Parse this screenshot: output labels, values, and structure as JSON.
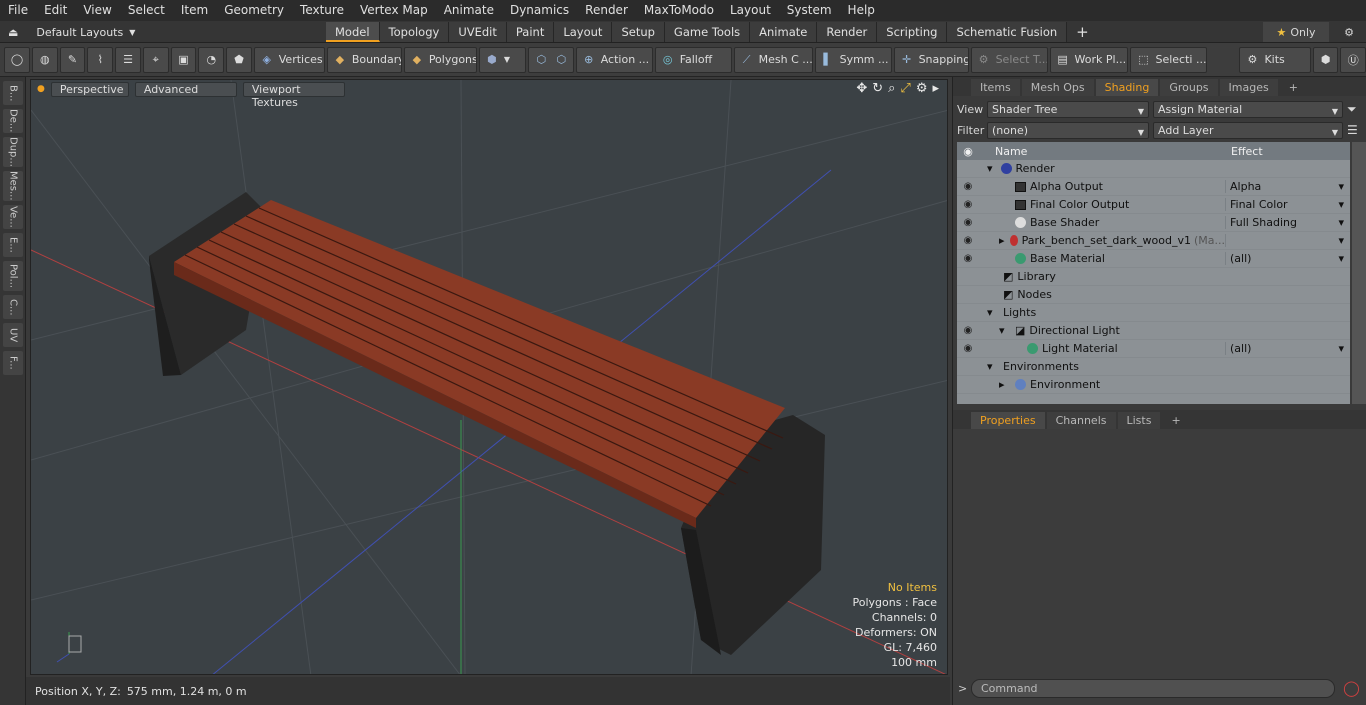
{
  "menu": [
    "File",
    "Edit",
    "View",
    "Select",
    "Item",
    "Geometry",
    "Texture",
    "Vertex Map",
    "Animate",
    "Dynamics",
    "Render",
    "MaxToModo",
    "Layout",
    "System",
    "Help"
  ],
  "layout_selector": "Default Layouts",
  "mode_tabs": [
    "Model",
    "Topology",
    "UVEdit",
    "Paint",
    "Layout",
    "Setup",
    "Game Tools",
    "Animate",
    "Render",
    "Scripting",
    "Schematic Fusion"
  ],
  "only_label": "Only",
  "toolbar": {
    "vertices": "Vertices",
    "boundary": "Boundary",
    "polygons": "Polygons",
    "action": "Action ...",
    "falloff": "Falloff",
    "mesh": "Mesh C ...",
    "symm": "Symm ...",
    "snapping": "Snapping",
    "select_t": "Select T...",
    "work_pl": "Work Pl...",
    "selecti": "Selecti ...",
    "kits": "Kits"
  },
  "left_tabs": [
    "B...",
    "De...",
    "Dup...",
    "Mes...",
    "Ve...",
    "E...",
    "Pol...",
    "C...",
    "UV",
    "F..."
  ],
  "viewport": {
    "perspective": "Perspective",
    "advanced": "Advanced",
    "viewport_textures": "Viewport Textures",
    "info": {
      "no_items": "No Items",
      "polygons": "Polygons : Face",
      "channels": "Channels: 0",
      "deformers": "Deformers: ON",
      "gl": "GL: 7,460",
      "unit": "100 mm"
    }
  },
  "status": {
    "label": "Position X, Y, Z:",
    "value": "575 mm, 1.24 m, 0 m"
  },
  "panel_tabs": [
    "Items",
    "Mesh Ops",
    "Shading",
    "Groups",
    "Images"
  ],
  "shading": {
    "view_label": "View",
    "view_value": "Shader Tree",
    "assign": "Assign Material",
    "filter_label": "Filter",
    "filter_value": "(none)",
    "add_layer": "Add Layer",
    "col_name": "Name",
    "col_effect": "Effect",
    "rows": [
      {
        "name": "Render",
        "effect": ""
      },
      {
        "name": "Alpha Output",
        "effect": "Alpha"
      },
      {
        "name": "Final Color Output",
        "effect": "Final Color"
      },
      {
        "name": "Base Shader",
        "effect": "Full Shading"
      },
      {
        "name": "Park_bench_set_dark_wood_v1",
        "suffix": "(Ma...",
        "effect": ""
      },
      {
        "name": "Base Material",
        "effect": "(all)"
      },
      {
        "name": "Library",
        "effect": ""
      },
      {
        "name": "Nodes",
        "effect": ""
      },
      {
        "name": "Lights",
        "effect": ""
      },
      {
        "name": "Directional Light",
        "effect": ""
      },
      {
        "name": "Light Material",
        "effect": "(all)"
      },
      {
        "name": "Environments",
        "effect": ""
      },
      {
        "name": "Environment",
        "effect": ""
      }
    ]
  },
  "lower_tabs": [
    "Properties",
    "Channels",
    "Lists"
  ],
  "command_placeholder": "Command",
  "colors": {
    "accent": "#f0a020",
    "wood": "#8a3a25",
    "base": "#2a2a2a",
    "viewport_bg": "#3b4145"
  }
}
